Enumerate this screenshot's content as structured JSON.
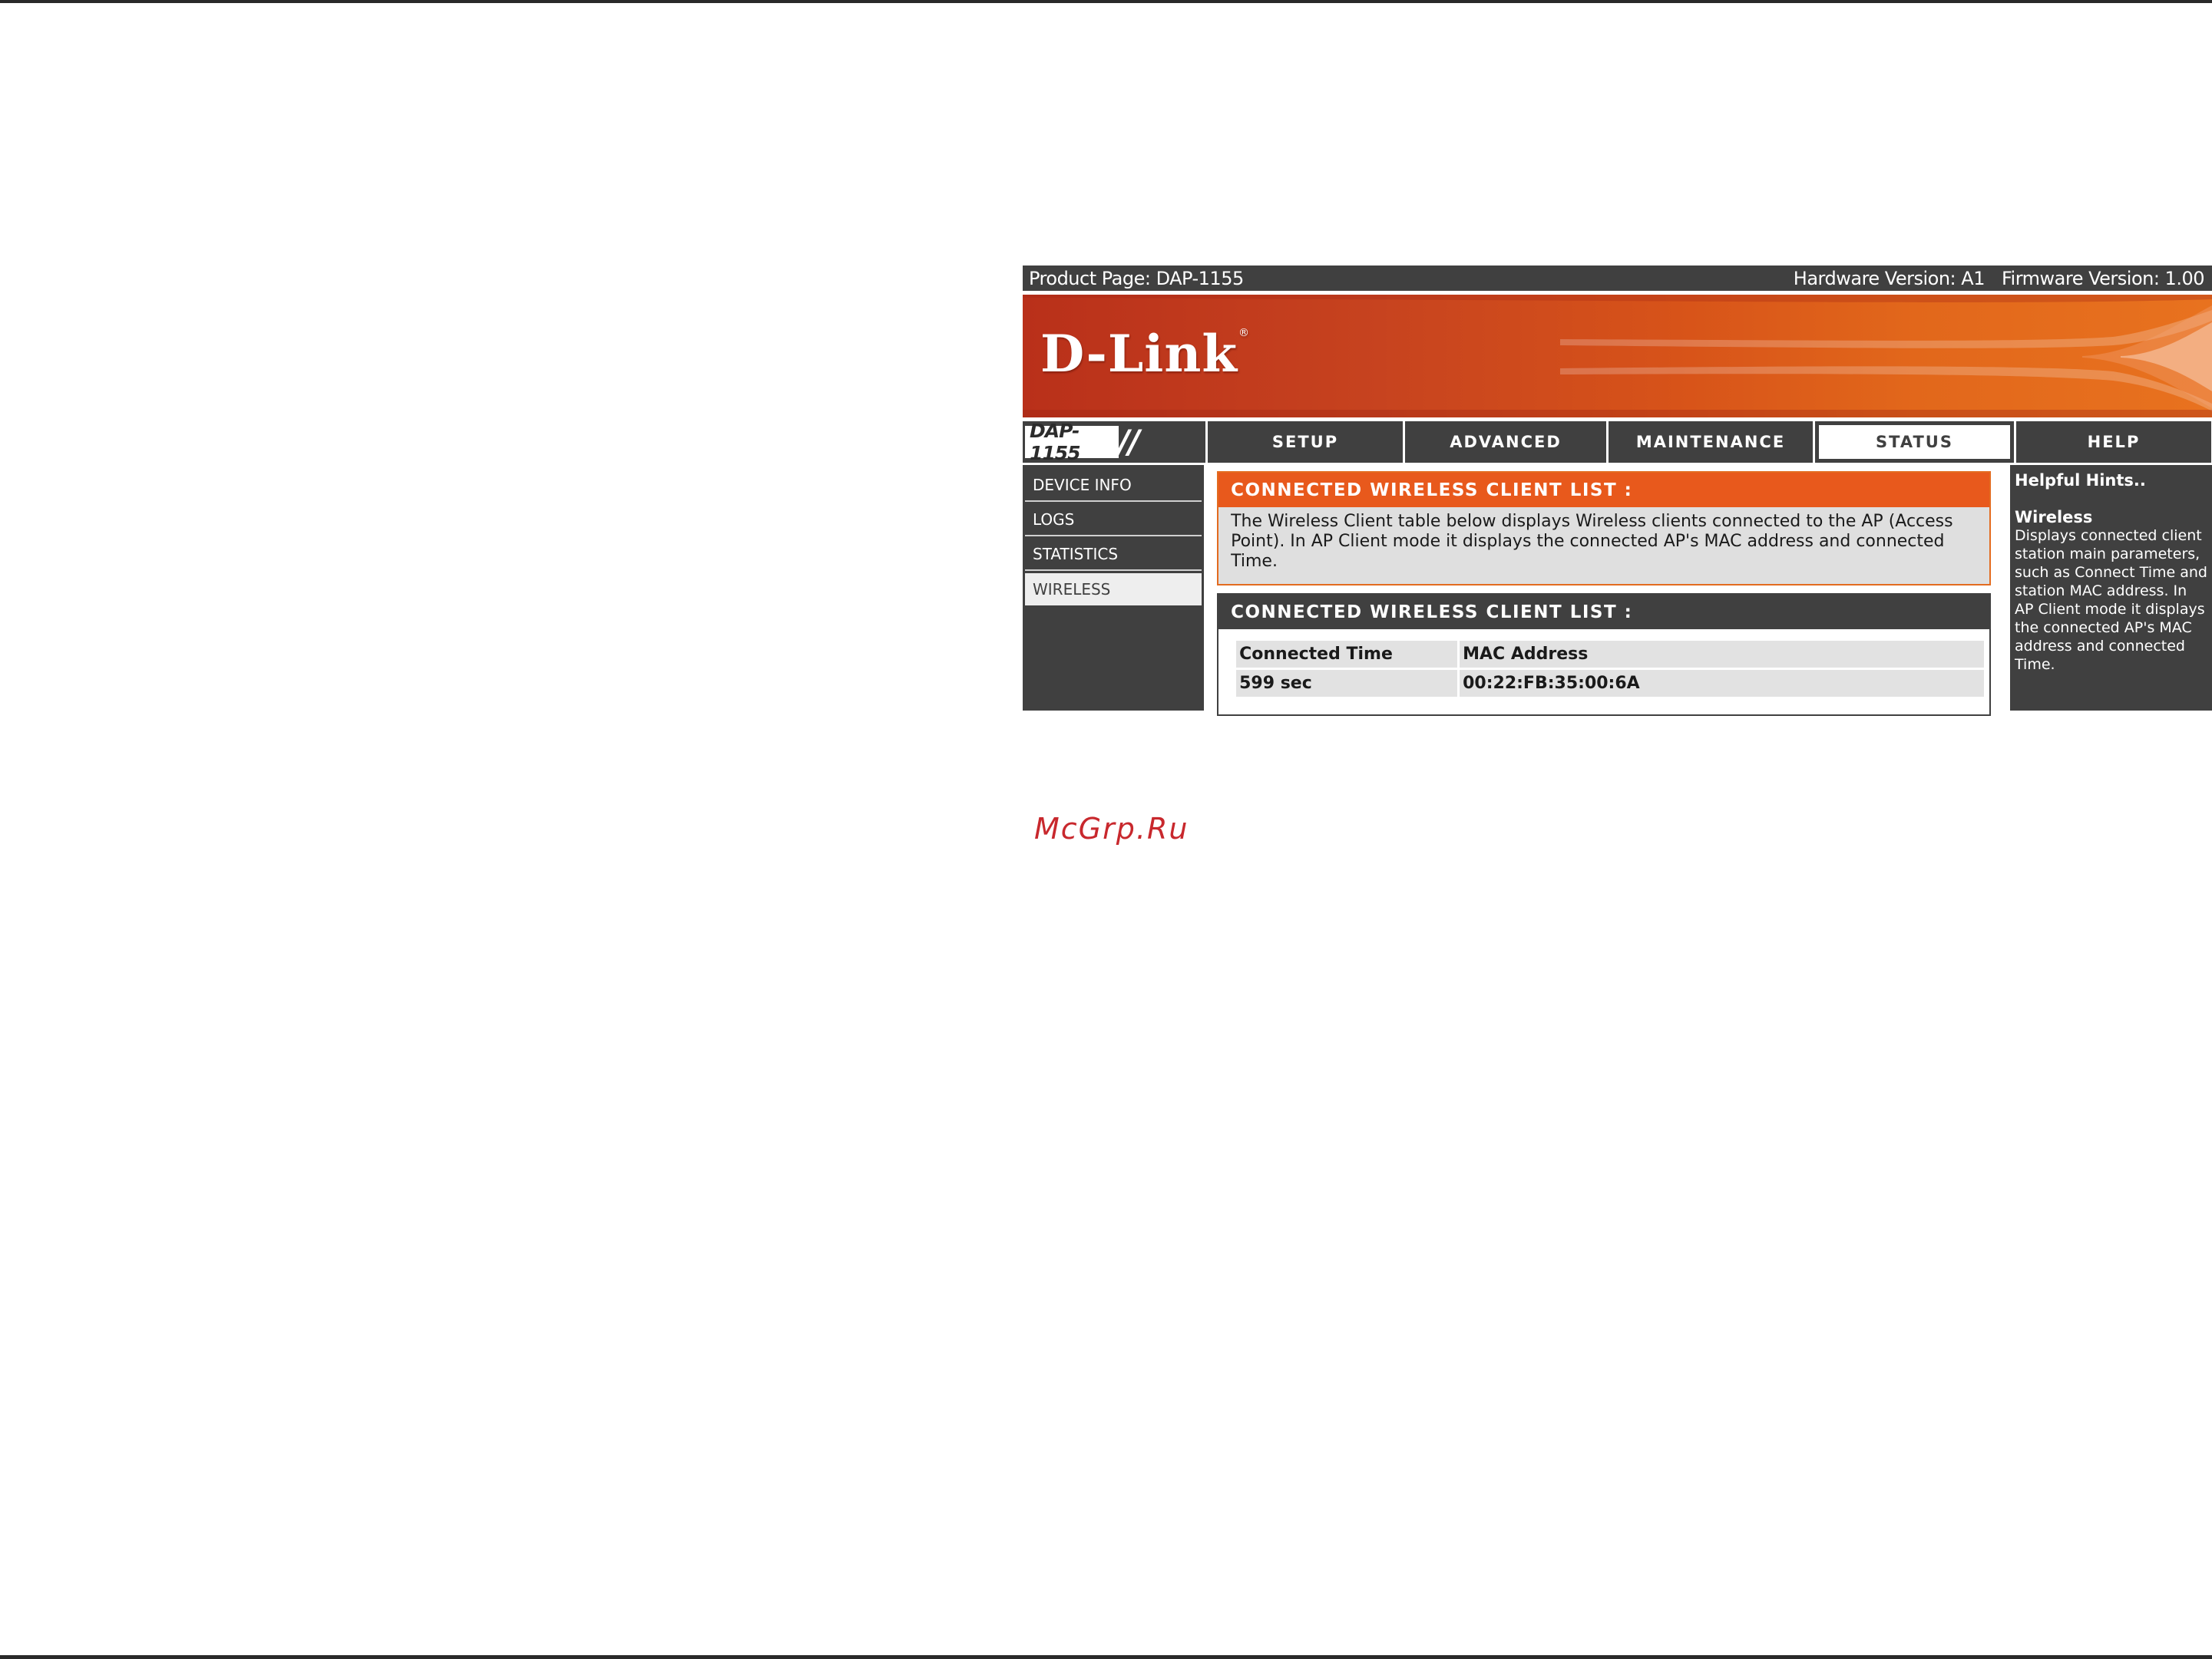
{
  "topbar": {
    "product": "Product Page: DAP-1155",
    "hardware": "Hardware Version: A1",
    "firmware": "Firmware Version: 1.00"
  },
  "brand": {
    "logo": "D-Link",
    "mark": "®",
    "model": "DAP-1155"
  },
  "tabs": [
    "SETUP",
    "ADVANCED",
    "MAINTENANCE",
    "STATUS",
    "HELP"
  ],
  "active_tab": "STATUS",
  "sidebar": {
    "items": [
      "DEVICE INFO",
      "LOGS",
      "STATISTICS",
      "WIRELESS"
    ],
    "active": "WIRELESS"
  },
  "intro": {
    "header": "CONNECTED WIRELESS CLIENT LIST :",
    "text": "The Wireless Client table below displays Wireless clients connected to the AP (Access Point). In AP Client mode it displays the connected AP's MAC address and connected Time."
  },
  "client_list": {
    "header": "CONNECTED WIRELESS CLIENT LIST :",
    "columns": [
      "Connected Time",
      "MAC Address"
    ],
    "rows": [
      [
        "599 sec",
        "00:22:FB:35:00:6A"
      ]
    ]
  },
  "hints": {
    "title": "Helpful Hints..",
    "subtitle": "Wireless",
    "text": "Displays connected client station main parameters, such as Connect Time and station MAC address. In AP Client mode it displays the connected AP's MAC address and connected Time."
  },
  "watermark": "McGrp.Ru",
  "colors": {
    "dark": "#404040",
    "accent": "#e8591c",
    "watermark": "#c8282d"
  }
}
